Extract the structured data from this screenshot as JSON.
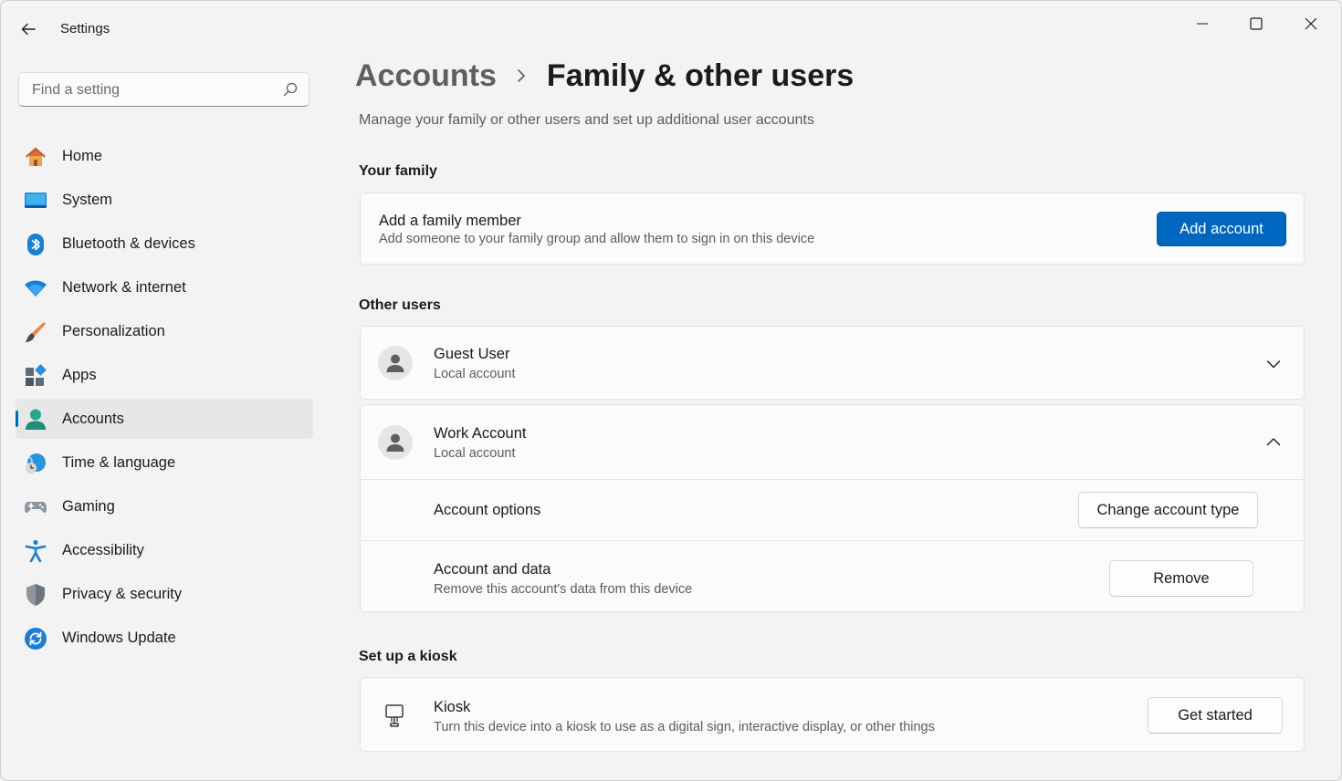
{
  "window": {
    "title": "Settings"
  },
  "search": {
    "placeholder": "Find a setting"
  },
  "sidebar": {
    "items": [
      {
        "label": "Home",
        "icon": "home-icon"
      },
      {
        "label": "System",
        "icon": "system-icon"
      },
      {
        "label": "Bluetooth & devices",
        "icon": "bluetooth-icon"
      },
      {
        "label": "Network & internet",
        "icon": "wifi-icon"
      },
      {
        "label": "Personalization",
        "icon": "brush-icon"
      },
      {
        "label": "Apps",
        "icon": "apps-icon"
      },
      {
        "label": "Accounts",
        "icon": "accounts-icon",
        "active": true
      },
      {
        "label": "Time & language",
        "icon": "globe-icon"
      },
      {
        "label": "Gaming",
        "icon": "gamepad-icon"
      },
      {
        "label": "Accessibility",
        "icon": "accessibility-icon"
      },
      {
        "label": "Privacy & security",
        "icon": "shield-icon"
      },
      {
        "label": "Windows Update",
        "icon": "update-icon"
      }
    ]
  },
  "header": {
    "breadcrumb_parent": "Accounts",
    "breadcrumb_current": "Family & other users",
    "description": "Manage your family or other users and set up additional user accounts"
  },
  "family": {
    "section_title": "Your family",
    "title": "Add a family member",
    "subtitle": "Add someone to your family group and allow them to sign in on this device",
    "button": "Add account"
  },
  "other_users": {
    "section_title": "Other users",
    "users": [
      {
        "name": "Guest User",
        "type": "Local account",
        "expanded": false
      },
      {
        "name": "Work Account",
        "type": "Local account",
        "expanded": true
      }
    ],
    "account_options": {
      "label": "Account options",
      "button": "Change account type"
    },
    "account_data": {
      "label": "Account and data",
      "subtitle": "Remove this account's data from this device",
      "button": "Remove"
    }
  },
  "kiosk": {
    "section_title": "Set up a kiosk",
    "title": "Kiosk",
    "subtitle": "Turn this device into a kiosk to use as a digital sign, interactive display, or other things",
    "button": "Get started"
  },
  "colors": {
    "accent": "#0067c0",
    "background": "#f3f3f3",
    "card": "#fbfbfb"
  }
}
